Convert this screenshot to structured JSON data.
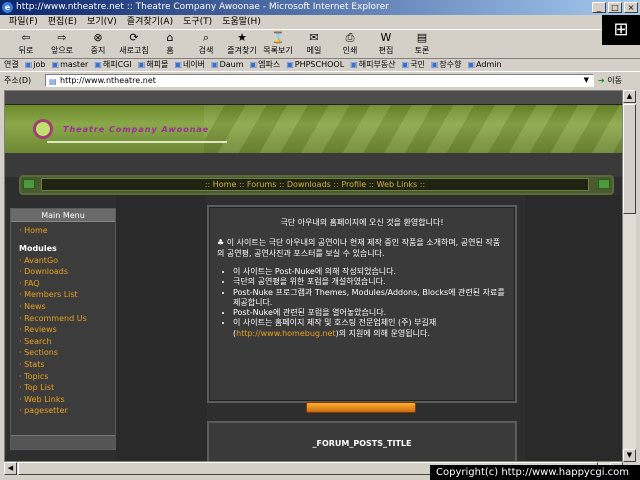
{
  "window": {
    "title": "http://www.ntheatre.net :: Theatre Company Awoonae - Microsoft Internet Explorer",
    "min": "_",
    "max": "□",
    "close": "×"
  },
  "menubar": [
    "파일(F)",
    "편집(E)",
    "보기(V)",
    "즐겨찾기(A)",
    "도구(T)",
    "도움말(H)"
  ],
  "toolbar": [
    {
      "icon": "back-icon",
      "glyph": "⇦",
      "label": "뒤로"
    },
    {
      "icon": "forward-icon",
      "glyph": "⇨",
      "label": "앞으로"
    },
    {
      "icon": "stop-icon",
      "glyph": "⊗",
      "label": "중지"
    },
    {
      "icon": "refresh-icon",
      "glyph": "⟳",
      "label": "새로고침"
    },
    {
      "icon": "home-icon",
      "glyph": "⌂",
      "label": "홈"
    },
    {
      "icon": "search-icon",
      "glyph": "⌕",
      "label": "검색"
    },
    {
      "icon": "favorites-icon",
      "glyph": "★",
      "label": "즐겨찾기"
    },
    {
      "icon": "history-icon",
      "glyph": "⌛",
      "label": "목록보기"
    },
    {
      "icon": "mail-icon",
      "glyph": "✉",
      "label": "메일"
    },
    {
      "icon": "print-icon",
      "glyph": "⎙",
      "label": "인쇄"
    },
    {
      "icon": "edit-icon",
      "glyph": "W",
      "label": "편집"
    },
    {
      "icon": "discuss-icon",
      "glyph": "▤",
      "label": "토론"
    }
  ],
  "links": {
    "label": "연결",
    "items": [
      "job",
      "master",
      "해피CGI",
      "해피몰",
      "네이버",
      "Daum",
      "엠파스",
      "PHPSCHOOL",
      "해피부동산",
      "국민",
      "장수향",
      "Admin"
    ]
  },
  "address": {
    "label": "주소(D)",
    "value": "http://www.ntheatre.net",
    "go_label": "이동"
  },
  "status": {
    "text": "Copyright(c) http://www.happycgi.com"
  },
  "site": {
    "banner_text": "Theatre Company Awoonae",
    "nav": [
      "Home",
      "Forums",
      "Downloads",
      "Profile",
      "Web Links"
    ],
    "sidebar": {
      "title": "Main Menu",
      "home": "Home",
      "modules_label": "Modules",
      "modules": [
        "AvantGo",
        "Downloads",
        "FAQ",
        "Members List",
        "News",
        "Recommend Us",
        "Reviews",
        "Search",
        "Sections",
        "Stats",
        "Topics",
        "Top List",
        "Web Links",
        "pagesetter"
      ]
    },
    "welcome": "극단 아우내의 홈페이지에 오신 것을 환영합니다!",
    "description": "♣ 이 사이트는 극단 아우내의 공연이나 현재 제작 중인 작품을 소개하며, 공연된 작품의 공연평, 공연사진과 포스터를 보실 수 있습니다.",
    "bullets": [
      "이 사이트는 Post-Nuke에 의해 작성되었습니다.",
      "극단의 공연평을 위한 포럼을 개설하였습니다.",
      "Post-Nuke 프로그램과 Themes, Modules/Addons, Blocks에 관련된 자료를 제공합니다.",
      "Post-Nuke에 관련된 포럼을 열어놓았습니다."
    ],
    "last_bullet_pre": "이 사이트는 홈페이지 제작 및 호스팅 전문업체인 (주) 부길재(",
    "last_bullet_url": "http://www.homebug.net",
    "last_bullet_post": ")의 지원에 의해 운영됩니다.",
    "forum_title": "_FORUM_POSTS_TITLE"
  }
}
